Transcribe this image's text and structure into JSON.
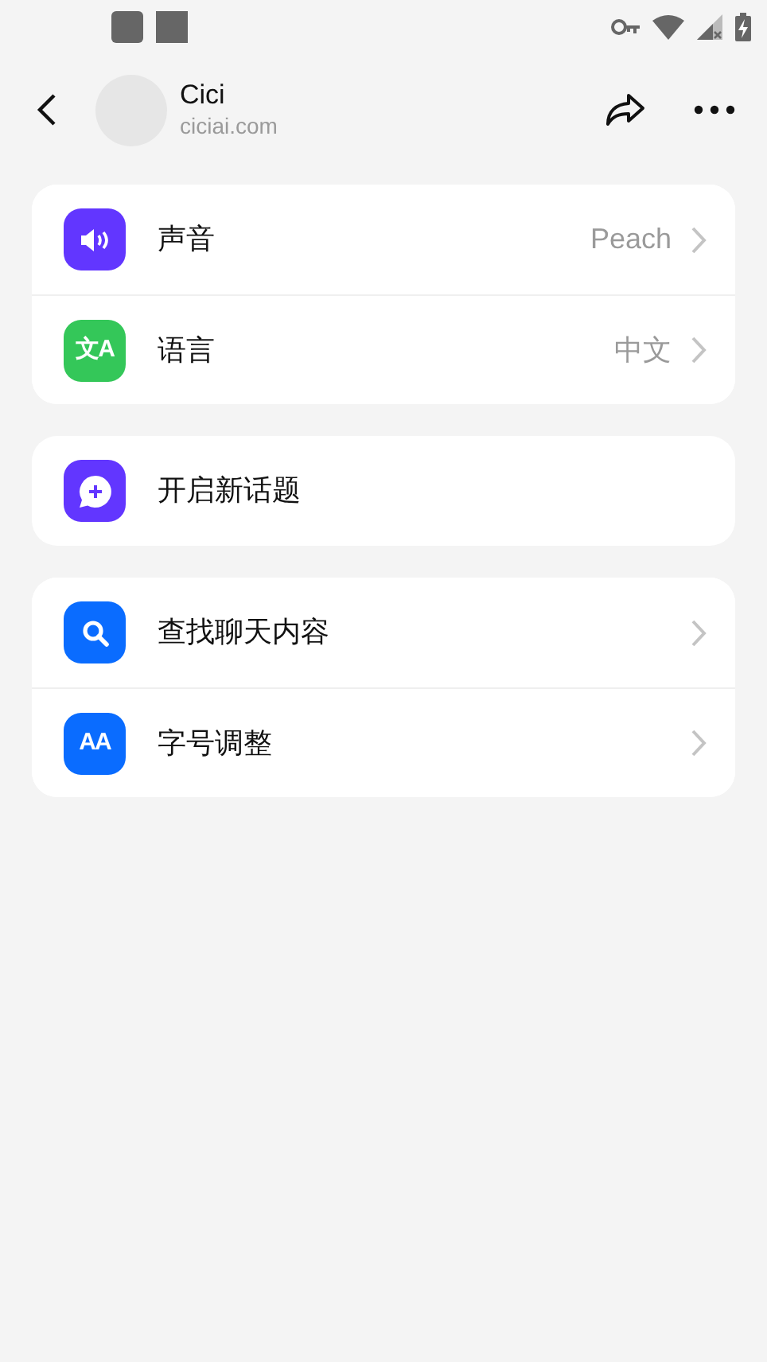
{
  "header": {
    "title": "Cici",
    "subtitle": "ciciai.com"
  },
  "groups": [
    {
      "items": [
        {
          "kind": "sound",
          "color": "#6236ff",
          "label": "声音",
          "value": "Peach",
          "chevron": true
        },
        {
          "kind": "translate",
          "color": "#34c759",
          "icon_text": "文A",
          "label": "语言",
          "value": "中文",
          "chevron": true
        }
      ]
    },
    {
      "items": [
        {
          "kind": "chat",
          "color": "#6236ff",
          "label": "开启新话题",
          "chevron": false
        }
      ]
    },
    {
      "items": [
        {
          "kind": "search",
          "color": "#0a6cff",
          "label": "查找聊天内容",
          "chevron": true
        },
        {
          "kind": "font",
          "color": "#0a6cff",
          "icon_text": "AA",
          "label": "字号调整",
          "chevron": true
        }
      ]
    }
  ]
}
